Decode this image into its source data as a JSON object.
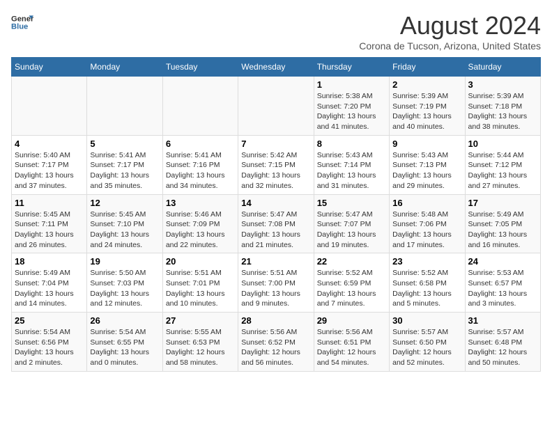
{
  "logo": {
    "general": "General",
    "blue": "Blue"
  },
  "header": {
    "title": "August 2024",
    "location": "Corona de Tucson, Arizona, United States"
  },
  "days_of_week": [
    "Sunday",
    "Monday",
    "Tuesday",
    "Wednesday",
    "Thursday",
    "Friday",
    "Saturday"
  ],
  "weeks": [
    [
      {
        "num": "",
        "info": ""
      },
      {
        "num": "",
        "info": ""
      },
      {
        "num": "",
        "info": ""
      },
      {
        "num": "",
        "info": ""
      },
      {
        "num": "1",
        "info": "Sunrise: 5:38 AM\nSunset: 7:20 PM\nDaylight: 13 hours and 41 minutes."
      },
      {
        "num": "2",
        "info": "Sunrise: 5:39 AM\nSunset: 7:19 PM\nDaylight: 13 hours and 40 minutes."
      },
      {
        "num": "3",
        "info": "Sunrise: 5:39 AM\nSunset: 7:18 PM\nDaylight: 13 hours and 38 minutes."
      }
    ],
    [
      {
        "num": "4",
        "info": "Sunrise: 5:40 AM\nSunset: 7:17 PM\nDaylight: 13 hours and 37 minutes."
      },
      {
        "num": "5",
        "info": "Sunrise: 5:41 AM\nSunset: 7:17 PM\nDaylight: 13 hours and 35 minutes."
      },
      {
        "num": "6",
        "info": "Sunrise: 5:41 AM\nSunset: 7:16 PM\nDaylight: 13 hours and 34 minutes."
      },
      {
        "num": "7",
        "info": "Sunrise: 5:42 AM\nSunset: 7:15 PM\nDaylight: 13 hours and 32 minutes."
      },
      {
        "num": "8",
        "info": "Sunrise: 5:43 AM\nSunset: 7:14 PM\nDaylight: 13 hours and 31 minutes."
      },
      {
        "num": "9",
        "info": "Sunrise: 5:43 AM\nSunset: 7:13 PM\nDaylight: 13 hours and 29 minutes."
      },
      {
        "num": "10",
        "info": "Sunrise: 5:44 AM\nSunset: 7:12 PM\nDaylight: 13 hours and 27 minutes."
      }
    ],
    [
      {
        "num": "11",
        "info": "Sunrise: 5:45 AM\nSunset: 7:11 PM\nDaylight: 13 hours and 26 minutes."
      },
      {
        "num": "12",
        "info": "Sunrise: 5:45 AM\nSunset: 7:10 PM\nDaylight: 13 hours and 24 minutes."
      },
      {
        "num": "13",
        "info": "Sunrise: 5:46 AM\nSunset: 7:09 PM\nDaylight: 13 hours and 22 minutes."
      },
      {
        "num": "14",
        "info": "Sunrise: 5:47 AM\nSunset: 7:08 PM\nDaylight: 13 hours and 21 minutes."
      },
      {
        "num": "15",
        "info": "Sunrise: 5:47 AM\nSunset: 7:07 PM\nDaylight: 13 hours and 19 minutes."
      },
      {
        "num": "16",
        "info": "Sunrise: 5:48 AM\nSunset: 7:06 PM\nDaylight: 13 hours and 17 minutes."
      },
      {
        "num": "17",
        "info": "Sunrise: 5:49 AM\nSunset: 7:05 PM\nDaylight: 13 hours and 16 minutes."
      }
    ],
    [
      {
        "num": "18",
        "info": "Sunrise: 5:49 AM\nSunset: 7:04 PM\nDaylight: 13 hours and 14 minutes."
      },
      {
        "num": "19",
        "info": "Sunrise: 5:50 AM\nSunset: 7:03 PM\nDaylight: 13 hours and 12 minutes."
      },
      {
        "num": "20",
        "info": "Sunrise: 5:51 AM\nSunset: 7:01 PM\nDaylight: 13 hours and 10 minutes."
      },
      {
        "num": "21",
        "info": "Sunrise: 5:51 AM\nSunset: 7:00 PM\nDaylight: 13 hours and 9 minutes."
      },
      {
        "num": "22",
        "info": "Sunrise: 5:52 AM\nSunset: 6:59 PM\nDaylight: 13 hours and 7 minutes."
      },
      {
        "num": "23",
        "info": "Sunrise: 5:52 AM\nSunset: 6:58 PM\nDaylight: 13 hours and 5 minutes."
      },
      {
        "num": "24",
        "info": "Sunrise: 5:53 AM\nSunset: 6:57 PM\nDaylight: 13 hours and 3 minutes."
      }
    ],
    [
      {
        "num": "25",
        "info": "Sunrise: 5:54 AM\nSunset: 6:56 PM\nDaylight: 13 hours and 2 minutes."
      },
      {
        "num": "26",
        "info": "Sunrise: 5:54 AM\nSunset: 6:55 PM\nDaylight: 13 hours and 0 minutes."
      },
      {
        "num": "27",
        "info": "Sunrise: 5:55 AM\nSunset: 6:53 PM\nDaylight: 12 hours and 58 minutes."
      },
      {
        "num": "28",
        "info": "Sunrise: 5:56 AM\nSunset: 6:52 PM\nDaylight: 12 hours and 56 minutes."
      },
      {
        "num": "29",
        "info": "Sunrise: 5:56 AM\nSunset: 6:51 PM\nDaylight: 12 hours and 54 minutes."
      },
      {
        "num": "30",
        "info": "Sunrise: 5:57 AM\nSunset: 6:50 PM\nDaylight: 12 hours and 52 minutes."
      },
      {
        "num": "31",
        "info": "Sunrise: 5:57 AM\nSunset: 6:48 PM\nDaylight: 12 hours and 50 minutes."
      }
    ]
  ]
}
